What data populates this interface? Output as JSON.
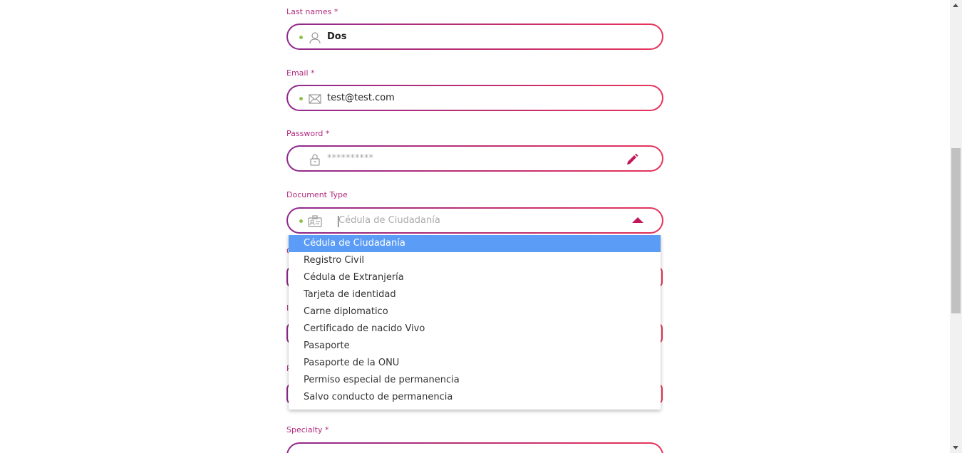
{
  "form": {
    "last_names": {
      "label": "Last names *",
      "value": "Dos",
      "icon": "user-icon"
    },
    "email": {
      "label": "Email *",
      "value": "test@test.com",
      "icon": "envelope-icon"
    },
    "password": {
      "label": "Password *",
      "value": "**********",
      "icon": "lock-icon",
      "edit_icon": "pencil-icon"
    },
    "document_type": {
      "label": "Document Type",
      "placeholder": "Cédula de Ciudadanía",
      "icon": "id-card-icon",
      "options": [
        "Cédula de Ciudadanía",
        "Registro Civil",
        "Cédula de Extranjería",
        "Tarjeta de identidad",
        "Carne diplomatico",
        "Certificado de nacido Vivo",
        "Pasaporte",
        "Pasaporte de la ONU",
        "Permiso especial de permanencia",
        "Salvo conducto de permanencia"
      ],
      "selected_index": 0
    },
    "specialty": {
      "label": "Specialty *"
    }
  },
  "colors": {
    "accent": "#c2185b",
    "gradient_start": "#8e2a8e",
    "gradient_end": "#e8345a",
    "selected": "#5b9cf6",
    "dot": "#8bc34a"
  }
}
